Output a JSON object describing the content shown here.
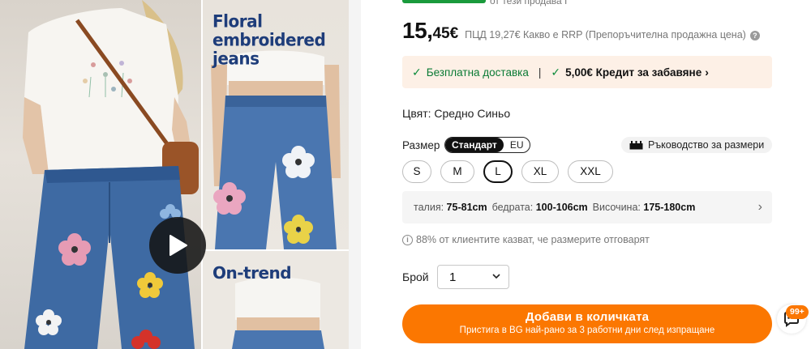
{
  "gallery": {
    "promo_title": "Floral embroidered jeans",
    "promo_subtitle": "On-trend"
  },
  "product": {
    "top_note": "от тези продава I",
    "price_int": "15,",
    "price_dec": "45€",
    "price_note": "ПЦД 19,27€ Какво е RRP (Препоръчителна продажна цена)",
    "perks": {
      "shipping": "Безплатна доставка",
      "separator": "|",
      "credit": "5,00€ Кредит за забавяне"
    },
    "color_label": "Цвят: Средно Синьо",
    "size_label": "Размер",
    "size_system": {
      "options": [
        "Стандарт",
        "EU"
      ],
      "selected": "Стандарт"
    },
    "size_guide": "Ръководство за размери",
    "sizes": [
      {
        "label": "S"
      },
      {
        "label": "M"
      },
      {
        "label": "L"
      },
      {
        "label": "XL"
      },
      {
        "label": "XXL"
      }
    ],
    "selected_size": "L",
    "measurements": {
      "waist_label": "талия:",
      "waist": "75-81cm",
      "hip_label": "бедрата:",
      "hip": "100-106cm",
      "height_label": "Височина:",
      "height": "175-180cm"
    },
    "fit_note": "88% от клиентите казват, че размерите отговарят",
    "quantity_label": "Брой",
    "quantity_value": "1",
    "add_to_cart": {
      "label": "Добави в количката",
      "sub": "Пристига в BG най-рано за 3 работни дни след изпращане"
    }
  },
  "chat": {
    "badge": "99+"
  },
  "colors": {
    "accent": "#fb7701",
    "success": "#0a8a3a",
    "perk_bg": "#fdf0e6"
  }
}
